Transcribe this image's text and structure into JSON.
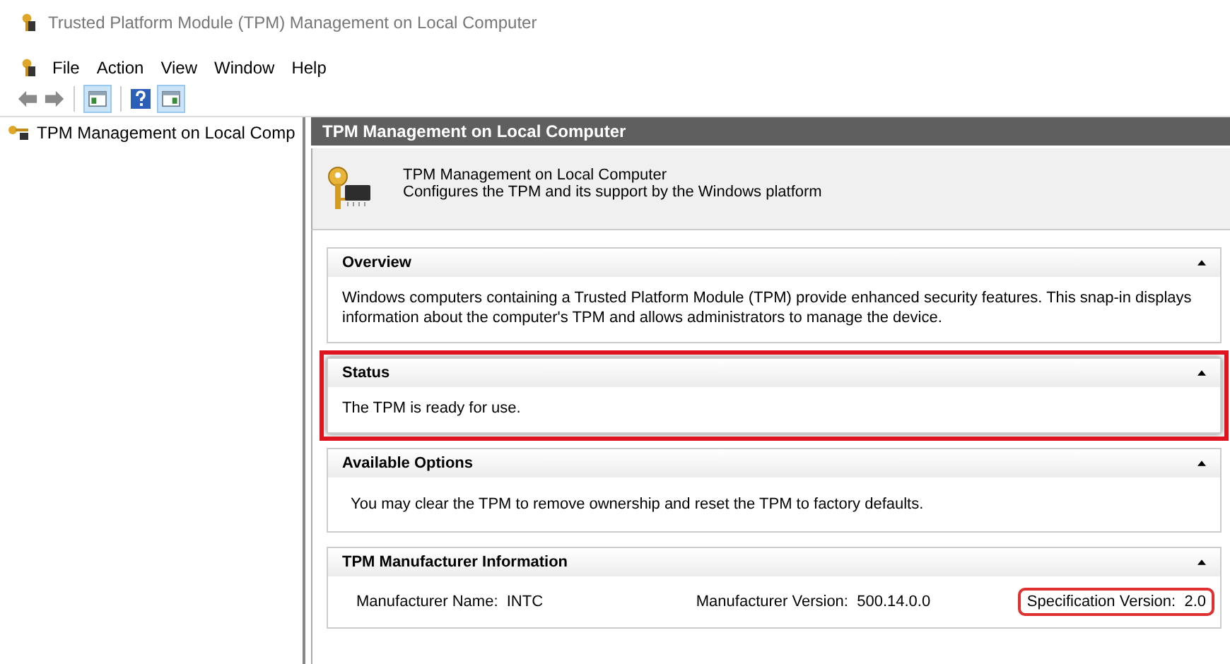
{
  "window": {
    "title": "Trusted Platform Module (TPM) Management on Local Computer"
  },
  "menu": [
    {
      "label": "File"
    },
    {
      "label": "Action"
    },
    {
      "label": "View"
    },
    {
      "label": "Window"
    },
    {
      "label": "Help"
    }
  ],
  "toolbar": [
    {
      "kind": "back"
    },
    {
      "kind": "forward"
    },
    {
      "kind": "separator"
    },
    {
      "kind": "pane",
      "selected": true
    },
    {
      "kind": "separator"
    },
    {
      "kind": "help"
    },
    {
      "kind": "pane2",
      "selected": true
    }
  ],
  "tree": {
    "label": "TPM Management on Local Comp",
    "selected": false
  },
  "content": {
    "header": "TPM Management on Local Computer",
    "intro": {
      "title": "TPM Management on Local Computer",
      "subtitle": "Configures the TPM and its support by the Windows platform"
    },
    "sections": [
      {
        "title": "Overview",
        "kind": "text",
        "highlighted": false,
        "text": "Windows computers containing a Trusted Platform Module (TPM) provide enhanced security features. This snap-in displays information about the computer's TPM and allows administrators to manage the device."
      },
      {
        "title": "Status",
        "kind": "text",
        "highlighted": true,
        "text": "The TPM is ready for use."
      },
      {
        "title": "Available Options",
        "kind": "text",
        "highlighted": false,
        "text": "You may clear the TPM to remove ownership and reset the TPM to factory defaults."
      },
      {
        "title": "TPM Manufacturer Information",
        "kind": "fields",
        "highlighted": false,
        "fields": [
          {
            "label": "Manufacturer Name:",
            "value": "INTC",
            "highlighted": false
          },
          {
            "label": "Manufacturer Version:",
            "value": "500.14.0.0",
            "highlighted": false
          },
          {
            "label": "Specification Version:",
            "value": "2.0",
            "highlighted": true
          }
        ]
      }
    ]
  }
}
